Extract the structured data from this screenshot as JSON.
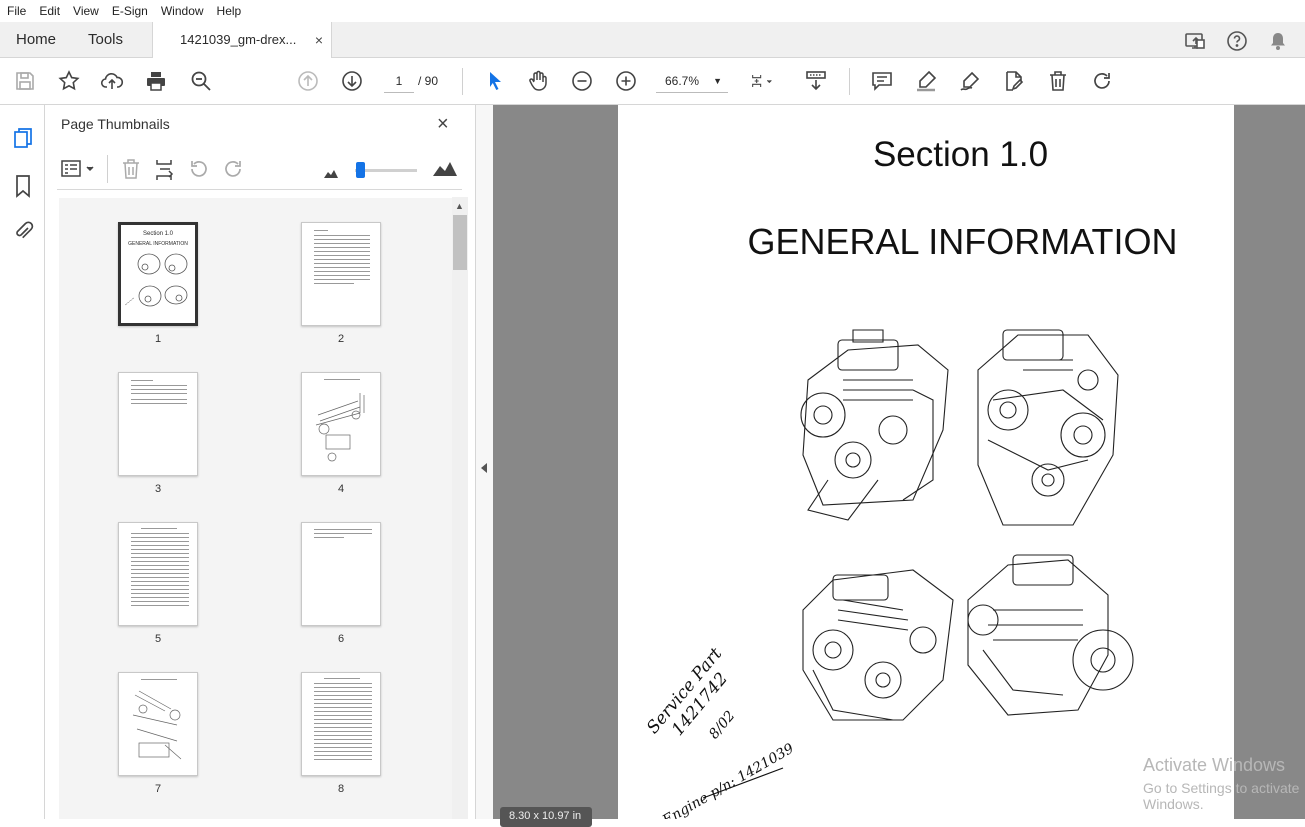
{
  "menu": [
    "File",
    "Edit",
    "View",
    "E-Sign",
    "Window",
    "Help"
  ],
  "tabs": {
    "home": "Home",
    "tools": "Tools",
    "document": "1421039_gm-drex...",
    "close": "×"
  },
  "toolbar": {
    "page_current": "1",
    "page_total": "/ 90",
    "zoom": "66.7%",
    "zoom_caret": "▼"
  },
  "panel": {
    "title": "Page Thumbnails",
    "close": "×"
  },
  "thumbnails": [
    "1",
    "2",
    "3",
    "4",
    "5",
    "6",
    "7",
    "8"
  ],
  "thumb1": {
    "title": "Section 1.0",
    "subtitle": "GENERAL INFORMATION"
  },
  "document": {
    "section_title": "Section 1.0",
    "heading": "GENERAL INFORMATION",
    "handwriting_1": "Service Part",
    "handwriting_2": "1421742",
    "handwriting_3": "8/02",
    "handwriting_4": "Engine p/n: 1421039"
  },
  "status": {
    "page_size": "8.30 x 10.97 in"
  },
  "watermark": {
    "line1": "Activate Windows",
    "line2": "Go to Settings to activate Windows."
  },
  "colors": {
    "accent_blue": "#1473e6",
    "doc_background": "#888888"
  }
}
